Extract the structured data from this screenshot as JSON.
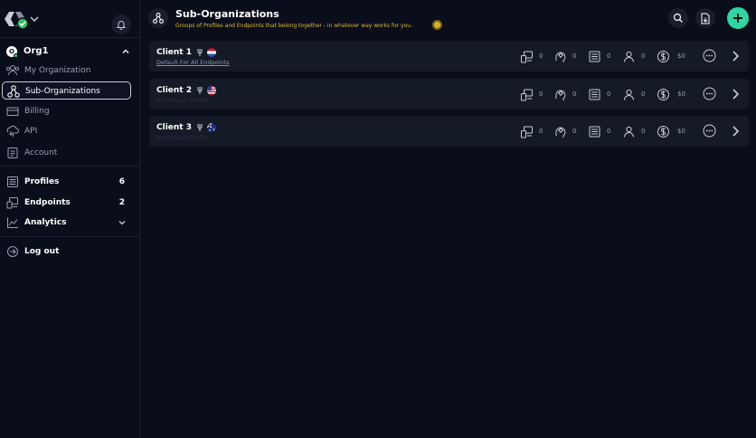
{
  "sidebar": {
    "org": {
      "badge": "O",
      "name": "Org1"
    },
    "nav": [
      {
        "label": "My Organization",
        "icon": "users-icon"
      },
      {
        "label": "Sub-Organizations",
        "icon": "sub-org-icon",
        "active": true
      },
      {
        "label": "Billing",
        "icon": "credit-card-icon"
      },
      {
        "label": "API",
        "icon": "api-icon"
      },
      {
        "label": "Account",
        "icon": "document-icon"
      }
    ],
    "sections": [
      {
        "label": "Profiles",
        "count": "6",
        "icon": "sliders-icon"
      },
      {
        "label": "Endpoints",
        "count": "2",
        "icon": "devices-icon"
      },
      {
        "label": "Analytics",
        "icon": "chart-icon"
      }
    ],
    "logout": {
      "label": "Log out",
      "icon": "logout-icon"
    }
  },
  "header": {
    "title": "Sub-Organizations",
    "subtitle": "Groups of Profiles and Endpoints that belong together - in whatever way works for you."
  },
  "clients": [
    {
      "name": "Client 1",
      "flag": "netherlands-flag",
      "subtitle": "Default For All Endpoints",
      "endpoints": "0",
      "ai": "0",
      "profiles": "0",
      "users": "0",
      "spend": "$0"
    },
    {
      "name": "Client 2",
      "flag": "usa-flag",
      "subtitle": "No Default Profile",
      "endpoints": "0",
      "ai": "0",
      "profiles": "0",
      "users": "0",
      "spend": "$0"
    },
    {
      "name": "Client 3",
      "flag": "australia-flag",
      "subtitle": "No Default Profile",
      "endpoints": "0",
      "ai": "0",
      "profiles": "0",
      "users": "0",
      "spend": "$0"
    }
  ],
  "colors": {
    "accent": "#2ed6a2",
    "background": "#0a0d1a",
    "card": "#151a27",
    "subtitle": "#e0b832"
  }
}
